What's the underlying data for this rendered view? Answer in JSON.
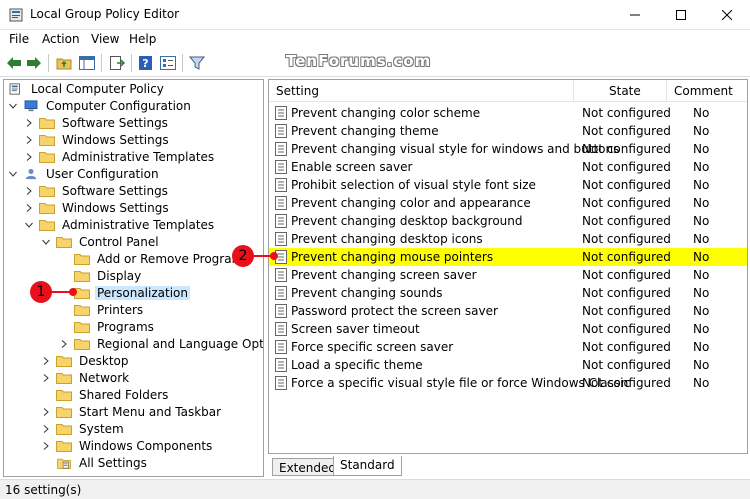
{
  "window": {
    "title": "Local Group Policy Editor",
    "minimize_icon": "minimize-icon",
    "maximize_icon": "maximize-icon",
    "close_icon": "close-icon"
  },
  "menu": [
    "File",
    "Action",
    "View",
    "Help"
  ],
  "watermark": "TenForums.com",
  "tree": {
    "root": "Local Computer Policy",
    "computer_config": "Computer Configuration",
    "cc_software": "Software Settings",
    "cc_windows": "Windows Settings",
    "cc_admin": "Administrative Templates",
    "user_config": "User Configuration",
    "uc_software": "Software Settings",
    "uc_windows": "Windows Settings",
    "uc_admin": "Administrative Templates",
    "control_panel": "Control Panel",
    "add_remove": "Add or Remove Programs",
    "display": "Display",
    "personalization": "Personalization",
    "printers": "Printers",
    "programs": "Programs",
    "regional": "Regional and Language Options",
    "desktop": "Desktop",
    "network": "Network",
    "shared_folders": "Shared Folders",
    "start_menu": "Start Menu and Taskbar",
    "system": "System",
    "win_components": "Windows Components",
    "all_settings": "All Settings"
  },
  "list": {
    "columns": [
      "Setting",
      "State",
      "Comment"
    ],
    "rows": [
      {
        "setting": "Prevent changing color scheme",
        "state": "Not configured",
        "comment": "No"
      },
      {
        "setting": "Prevent changing theme",
        "state": "Not configured",
        "comment": "No"
      },
      {
        "setting": "Prevent changing visual style for windows and buttons",
        "state": "Not configured",
        "comment": "No"
      },
      {
        "setting": "Enable screen saver",
        "state": "Not configured",
        "comment": "No"
      },
      {
        "setting": "Prohibit selection of visual style font size",
        "state": "Not configured",
        "comment": "No"
      },
      {
        "setting": "Prevent changing color and appearance",
        "state": "Not configured",
        "comment": "No"
      },
      {
        "setting": "Prevent changing desktop background",
        "state": "Not configured",
        "comment": "No"
      },
      {
        "setting": "Prevent changing desktop icons",
        "state": "Not configured",
        "comment": "No"
      },
      {
        "setting": "Prevent changing mouse pointers",
        "state": "Not configured",
        "comment": "No"
      },
      {
        "setting": "Prevent changing screen saver",
        "state": "Not configured",
        "comment": "No"
      },
      {
        "setting": "Prevent changing sounds",
        "state": "Not configured",
        "comment": "No"
      },
      {
        "setting": "Password protect the screen saver",
        "state": "Not configured",
        "comment": "No"
      },
      {
        "setting": "Screen saver timeout",
        "state": "Not configured",
        "comment": "No"
      },
      {
        "setting": "Force specific screen saver",
        "state": "Not configured",
        "comment": "No"
      },
      {
        "setting": "Load a specific theme",
        "state": "Not configured",
        "comment": "No"
      },
      {
        "setting": "Force a specific visual style file or force Windows Classic",
        "state": "Not configured",
        "comment": "No"
      }
    ],
    "highlight_color": "#ffff00"
  },
  "tabs": [
    "Extended",
    "Standard"
  ],
  "status": "16 setting(s)",
  "callouts": {
    "one": "1",
    "two": "2",
    "color": "#e8111b"
  }
}
